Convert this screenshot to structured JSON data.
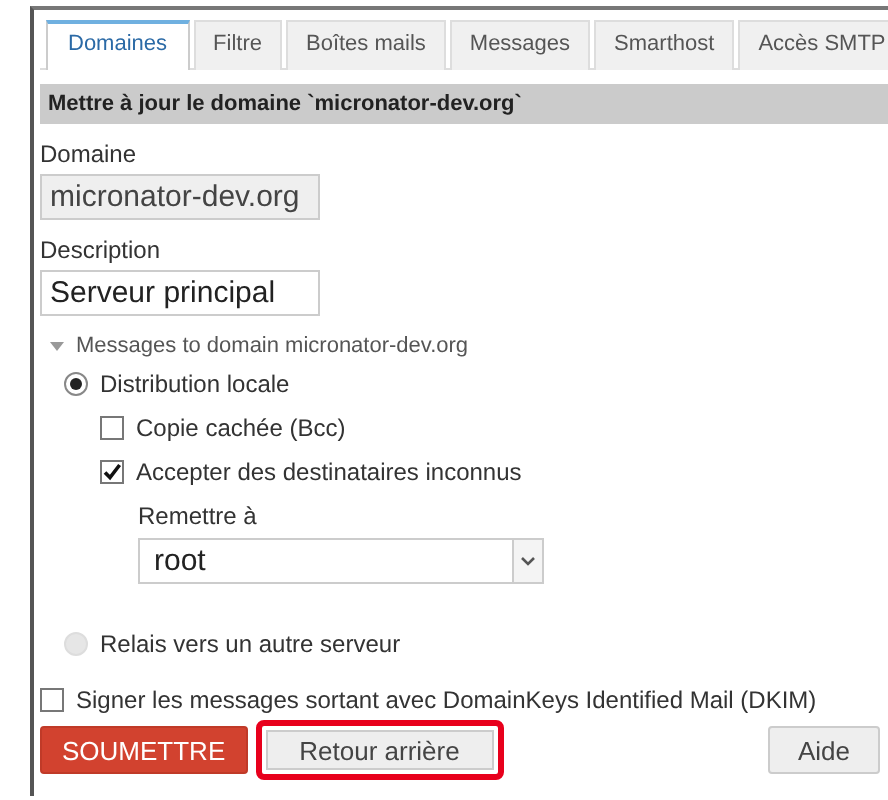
{
  "tabs": [
    {
      "label": "Domaines",
      "selected": true
    },
    {
      "label": "Filtre",
      "selected": false
    },
    {
      "label": "Boîtes mails",
      "selected": false
    },
    {
      "label": "Messages",
      "selected": false
    },
    {
      "label": "Smarthost",
      "selected": false
    },
    {
      "label": "Accès SMTP",
      "selected": false
    }
  ],
  "header": "Mettre à jour le domaine `micronator-dev.org`",
  "domain": {
    "label": "Domaine",
    "value": "micronator-dev.org",
    "disabled": true
  },
  "description": {
    "label": "Description",
    "value": "Serveur principal",
    "disabled": false
  },
  "delivery": {
    "legend": "Messages to domain micronator-dev.org",
    "expanded": true,
    "options": [
      {
        "label": "Distribution locale",
        "selected": true,
        "disabled": false
      },
      {
        "label": "Relais vers un autre serveur",
        "selected": false,
        "disabled": true
      }
    ],
    "checkboxes": [
      {
        "label": "Copie cachée (Bcc)",
        "checked": false
      },
      {
        "label": "Accepter des destinataires inconnus",
        "checked": true
      }
    ],
    "forward": {
      "label": "Remettre à",
      "value": "root"
    }
  },
  "dkim": {
    "label": "Signer les messages sortant avec DomainKeys Identified Mail (DKIM)",
    "checked": false
  },
  "buttons": [
    {
      "label": "SOUMETTRE",
      "kind": "primary",
      "highlighted": false
    },
    {
      "label": "Retour arrière",
      "kind": "secondary",
      "highlighted": true
    },
    {
      "label": "Aide",
      "kind": "help",
      "highlighted": false
    }
  ]
}
